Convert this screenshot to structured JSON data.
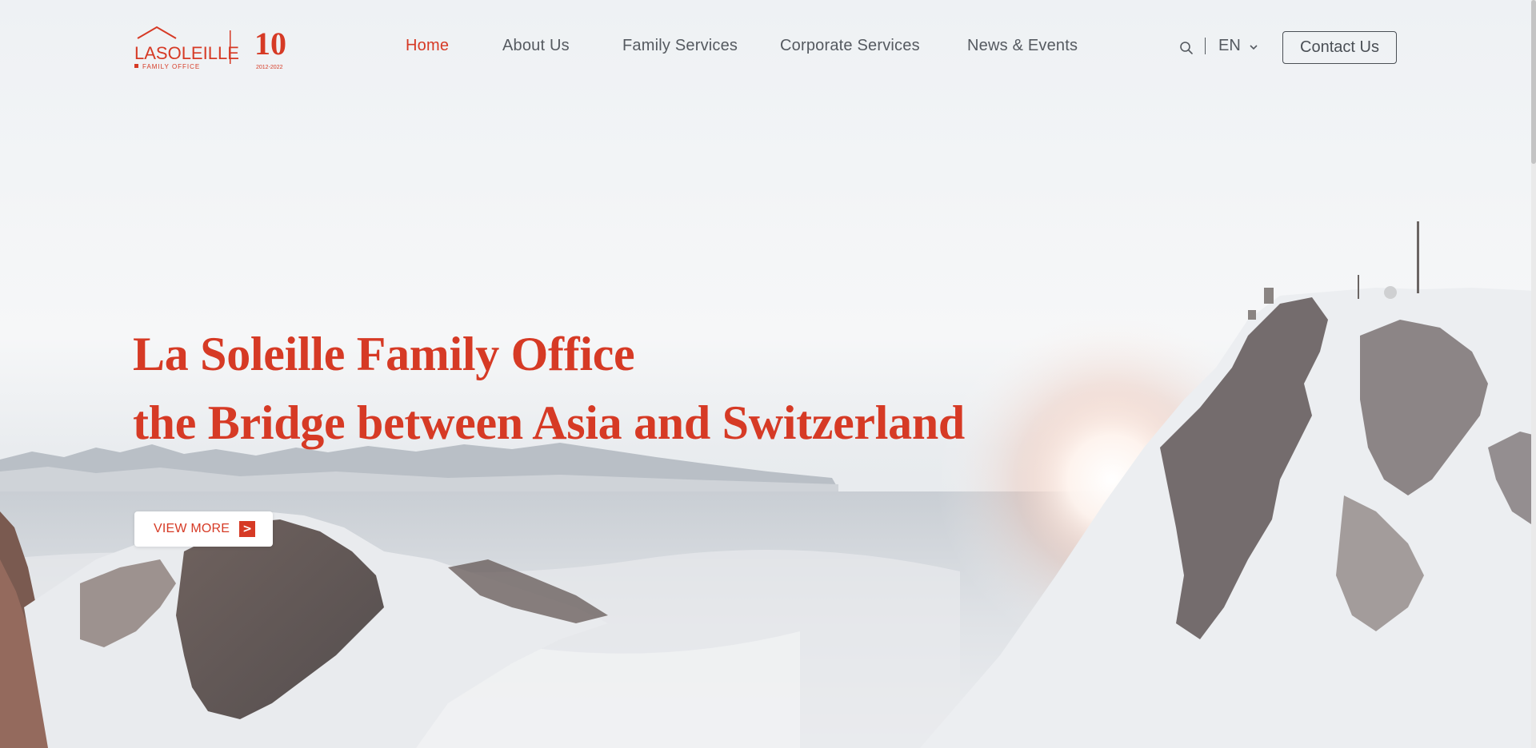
{
  "brand": {
    "logo_text_large": "LASOLEILLE",
    "logo_text_small": "FAMILY OFFICE",
    "anniversary_number": "10",
    "anniversary_years": "2012-2022",
    "accent_color": "#d63a25"
  },
  "nav": {
    "items": [
      {
        "label": "Home",
        "active": true
      },
      {
        "label": "About Us",
        "active": false
      },
      {
        "label": "Family Services",
        "active": false
      },
      {
        "label": "Corporate Services",
        "active": false
      },
      {
        "label": "News & Events",
        "active": false
      }
    ],
    "search_icon": "search-icon",
    "language": "EN",
    "contact_label": "Contact Us"
  },
  "hero": {
    "headline_line1": "La Soleille Family Office",
    "headline_line2": "the Bridge between Asia and Switzerland",
    "cta_label": "VIEW MORE",
    "cta_arrow": ">"
  }
}
